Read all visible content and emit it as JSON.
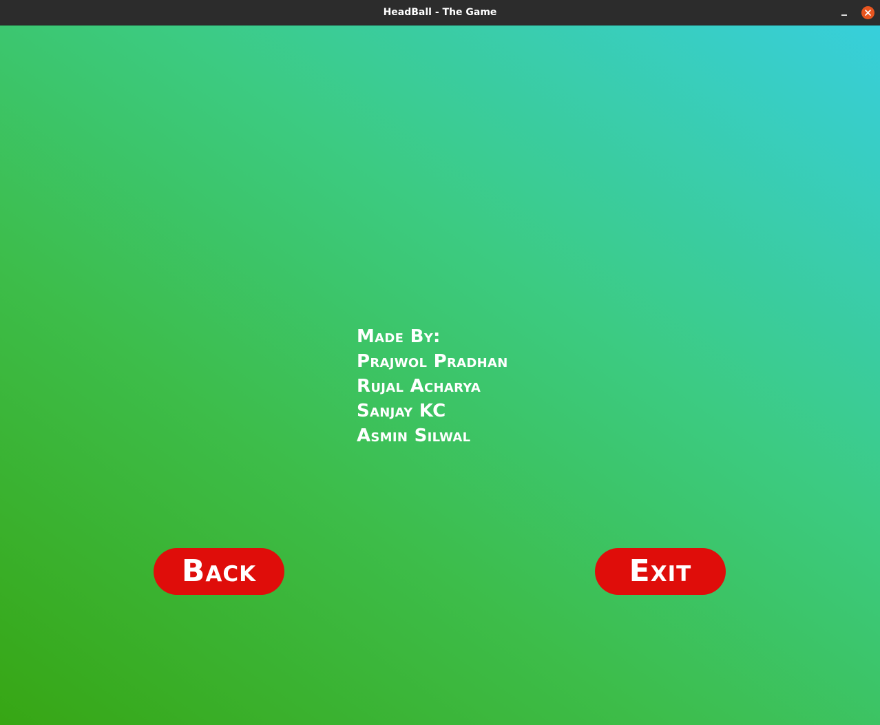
{
  "window": {
    "title": "HeadBall - The Game"
  },
  "credits": {
    "heading": "Made By:",
    "names": [
      "Prajwol Pradhan",
      "Rujal Acharya",
      "Sanjay KC",
      "Asmin Silwal"
    ]
  },
  "buttons": {
    "back_label": "Back",
    "exit_label": "Exit"
  },
  "colors": {
    "button": "#df0d0a",
    "titlebar": "#2c2c2c",
    "close_button": "#e8551f",
    "background_start": "#37a614",
    "background_end": "#37cfdc"
  }
}
